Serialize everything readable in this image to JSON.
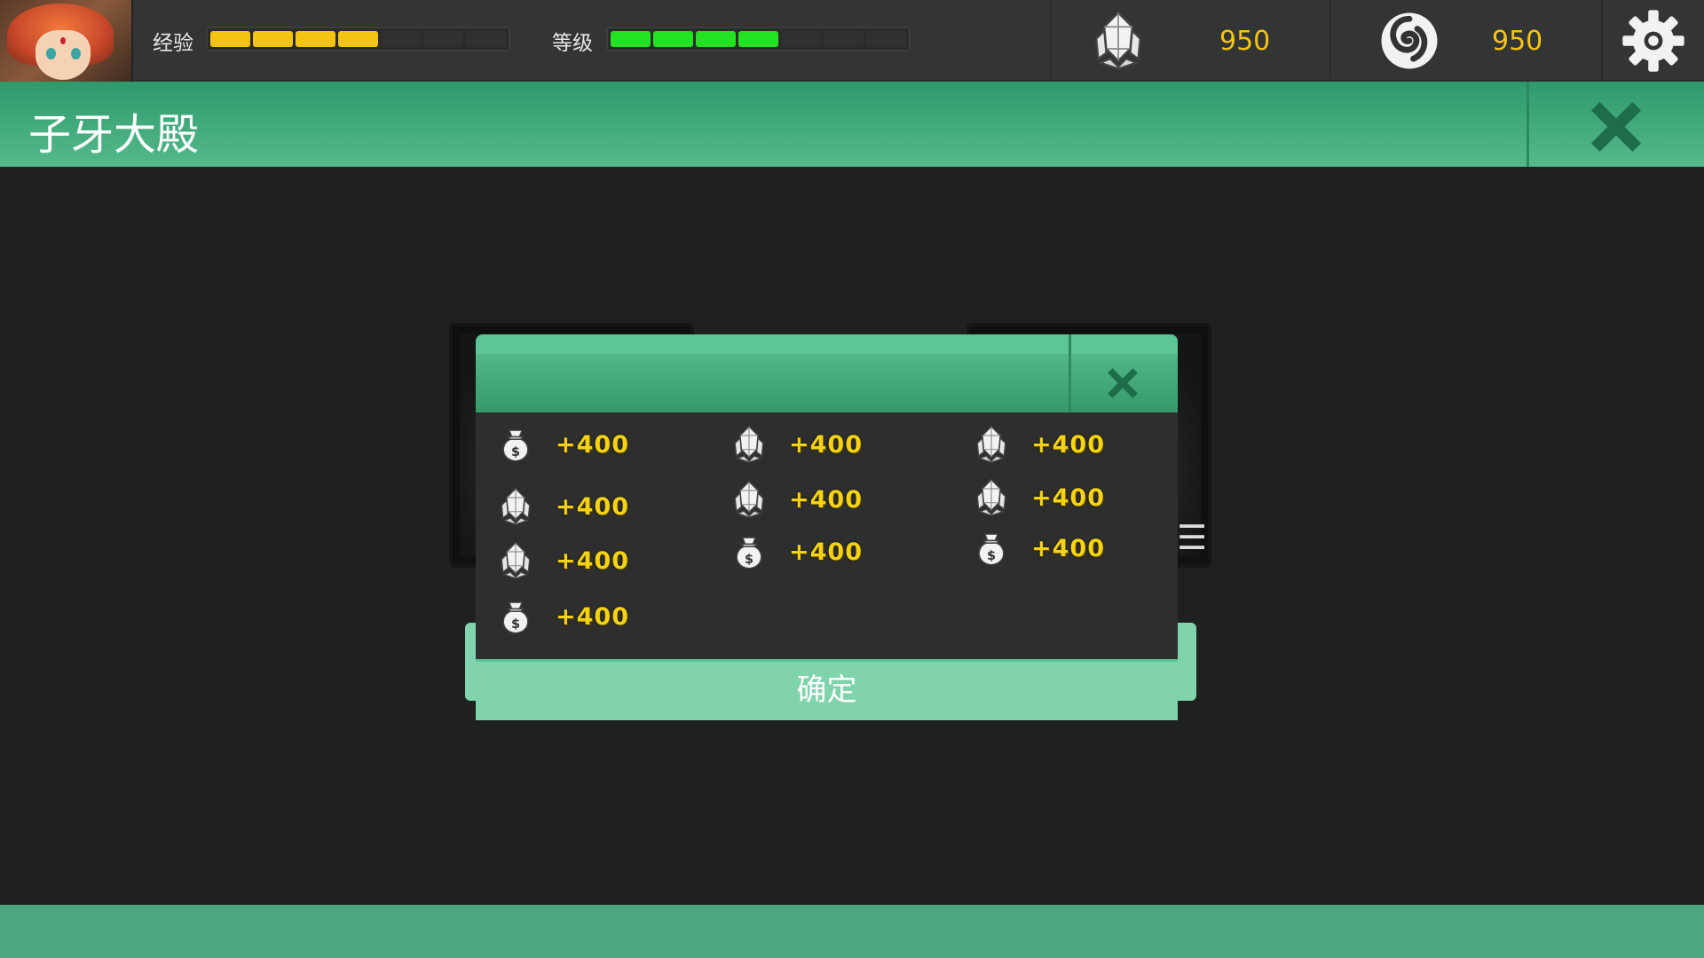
{
  "hud": {
    "exp_label": "经验",
    "level_label": "等级",
    "exp_segments_total": 7,
    "exp_segments_filled": 4,
    "level_segments_total": 7,
    "level_segments_filled": 4,
    "crystal_value": "950",
    "swirl_value": "950",
    "colors": {
      "exp": "#f5c410",
      "level": "#22e222",
      "value": "#f5c410"
    }
  },
  "titlebar": {
    "title": "子牙大殿"
  },
  "dialog": {
    "confirm_label": "确定",
    "rewards": [
      {
        "icon": "money-bag-icon",
        "amount": "+400"
      },
      {
        "icon": "crystal-icon",
        "amount": "+400"
      },
      {
        "icon": "crystal-icon",
        "amount": "+400"
      },
      {
        "icon": "money-bag-icon",
        "amount": "+400"
      },
      {
        "icon": "crystal-icon",
        "amount": "+400"
      },
      {
        "icon": "crystal-icon",
        "amount": "+400"
      },
      {
        "icon": "money-bag-icon",
        "amount": "+400"
      },
      {
        "icon": "crystal-icon",
        "amount": "+400"
      },
      {
        "icon": "crystal-icon",
        "amount": "+400"
      },
      {
        "icon": "money-bag-icon",
        "amount": "+400"
      }
    ]
  }
}
